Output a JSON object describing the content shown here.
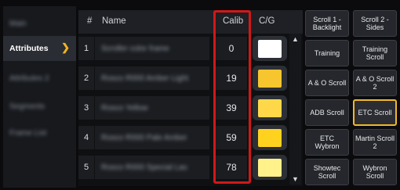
{
  "sidebar": {
    "items": [
      {
        "label": "Main"
      },
      {
        "label": "Attributes",
        "active": true
      },
      {
        "label": "Attributes 2"
      },
      {
        "label": "Segments"
      },
      {
        "label": "Frame List"
      }
    ]
  },
  "table": {
    "headers": {
      "index": "#",
      "name": "Name",
      "calib": "Calib",
      "cg": "C/G"
    },
    "rows": [
      {
        "index": "1",
        "name": "Scroller color frame",
        "calib": "0",
        "color": "#ffffff"
      },
      {
        "index": "2",
        "name": "Rosco R000 Amber Light",
        "calib": "19",
        "color": "#f7c52e"
      },
      {
        "index": "3",
        "name": "Rosco Yellow",
        "calib": "39",
        "color": "#ffd84a"
      },
      {
        "index": "4",
        "name": "Rosco R000 Pale Amber",
        "calib": "59",
        "color": "#ffd21f"
      },
      {
        "index": "5",
        "name": "Rosco R000 Special Lav.",
        "calib": "78",
        "color": "#fff28a"
      }
    ]
  },
  "buttons": [
    {
      "label": "Scroll 1 - Backlight"
    },
    {
      "label": "Scroll 2 - Sides"
    },
    {
      "label": "Training"
    },
    {
      "label": "Training Scroll"
    },
    {
      "label": "A & O Scroll"
    },
    {
      "label": "A & O Scroll 2"
    },
    {
      "label": "ADB Scroll"
    },
    {
      "label": "ETC Scroll",
      "selected": true
    },
    {
      "label": "ETC Wybron"
    },
    {
      "label": "Martin Scroll 2"
    },
    {
      "label": "Showtec Scroll"
    },
    {
      "label": "Wybron Scroll"
    }
  ],
  "colors": {
    "accent": "#f0b82b",
    "highlight": "#d21818"
  }
}
